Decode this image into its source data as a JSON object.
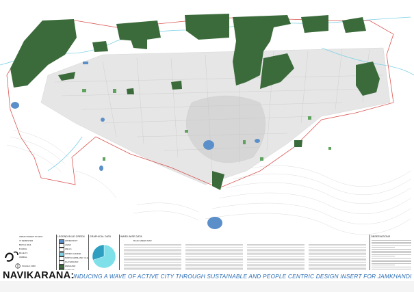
{
  "sheet": {
    "title_main": "NAVIKARANA:",
    "title_sub": "INDUCING A WAVE OF ACTIVE CITY THROUGH SUSTAINABLE AND PEOPLE CENTRIC DESIGN INSERT FOR JAMKHANDI"
  },
  "info_block": {
    "studio": "URBAN INSERT STUDIO",
    "semester": "IX SEMESTER",
    "batch": "BATCH 2014",
    "program": "B.ARCH",
    "sheet_no": "BLUE-T2",
    "sheet_name": "ISOBIAL",
    "scale": "SCALE 1:4000"
  },
  "legend": {
    "title": "LEGEND BLUE GREEN",
    "items": [
      {
        "label": "WATER BODY",
        "color": "#5b8fc9"
      },
      {
        "label": "LAKES",
        "color": "#ffffff"
      },
      {
        "label": "WELLS",
        "color": "#ffffff"
      },
      {
        "label": "WATER CHANNEL",
        "color": "#7fd1e4"
      },
      {
        "label": "NORTH FARMLAND / CLEARING",
        "color": "#ffffff"
      },
      {
        "label": "PLAYGROUND",
        "color": "#ffffff"
      },
      {
        "label": "FARMLAND",
        "color": "#3b6b3b"
      },
      {
        "label": "GARDENS",
        "color": "#5fa35f"
      },
      {
        "label": "FOREST",
        "color": "#ffffff"
      }
    ]
  },
  "graphical_data": {
    "title": "GRAPHICAL DATA",
    "chart_data": {
      "type": "pie",
      "labels": [
        "",
        ""
      ],
      "values": [
        70,
        30
      ],
      "colors": [
        "#7fe0ea",
        "#2e9fc0"
      ]
    }
  },
  "ward_data": {
    "title": "WARD WISE DATA",
    "subtitle": "BLUE GREEN MAP"
  },
  "observations": {
    "title": "OBSERVATIONS"
  },
  "colors": {
    "farmland": "#3b6b3b",
    "water": "#5b8fc9",
    "channel": "#7fd1e4",
    "boundary": "#d9534f",
    "title_blue": "#2a6db5"
  }
}
